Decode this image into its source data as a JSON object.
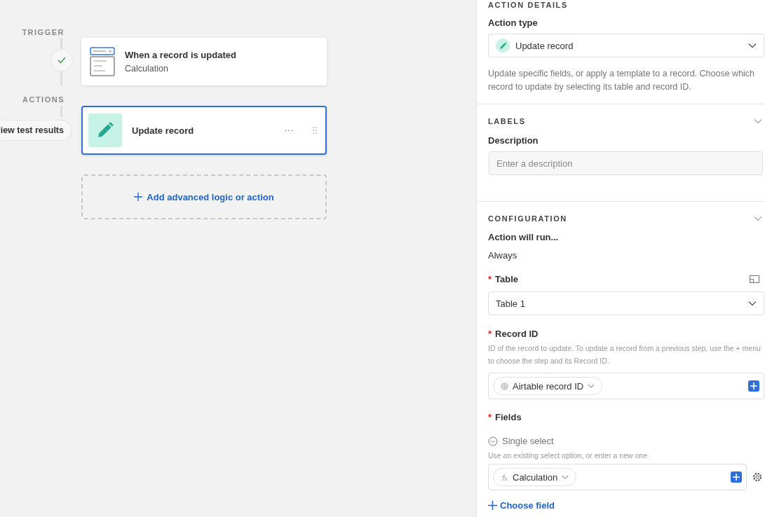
{
  "canvas": {
    "trigger_label": "TRIGGER",
    "trigger": {
      "title": "When a record is updated",
      "subtitle": "Calculation",
      "completed": true
    },
    "actions_label": "ACTIONS",
    "test_results_button": "iew test results",
    "actions": [
      {
        "title": "Update record",
        "selected": true
      }
    ],
    "add_button": "Add advanced logic or action"
  },
  "panel": {
    "action_details": {
      "heading": "ACTION DETAILS",
      "type_label": "Action type",
      "type_value": "Update record",
      "description": "Update specific fields, or apply a template to a record. Choose which record to update by selecting its table and record ID."
    },
    "labels": {
      "heading": "LABELS",
      "description_label": "Description",
      "description_placeholder": "Enter a description"
    },
    "configuration": {
      "heading": "CONFIGURATION",
      "run_label": "Action will run...",
      "run_value": "Always",
      "table": {
        "marker": "*",
        "label": "Table",
        "value": "Table 1"
      },
      "record_id": {
        "marker": "*",
        "label": "Record ID",
        "help": "ID of the record to update. To update a record from a previous step, use the + menu to choose the step and its Record ID.",
        "token": "Airtable record ID"
      },
      "fields": {
        "marker": "*",
        "label": "Fields",
        "field_name": "Single select",
        "help": "Use an existing select option, or enter a new one",
        "token": "Calculation"
      },
      "choose_field": "Choose field"
    }
  }
}
